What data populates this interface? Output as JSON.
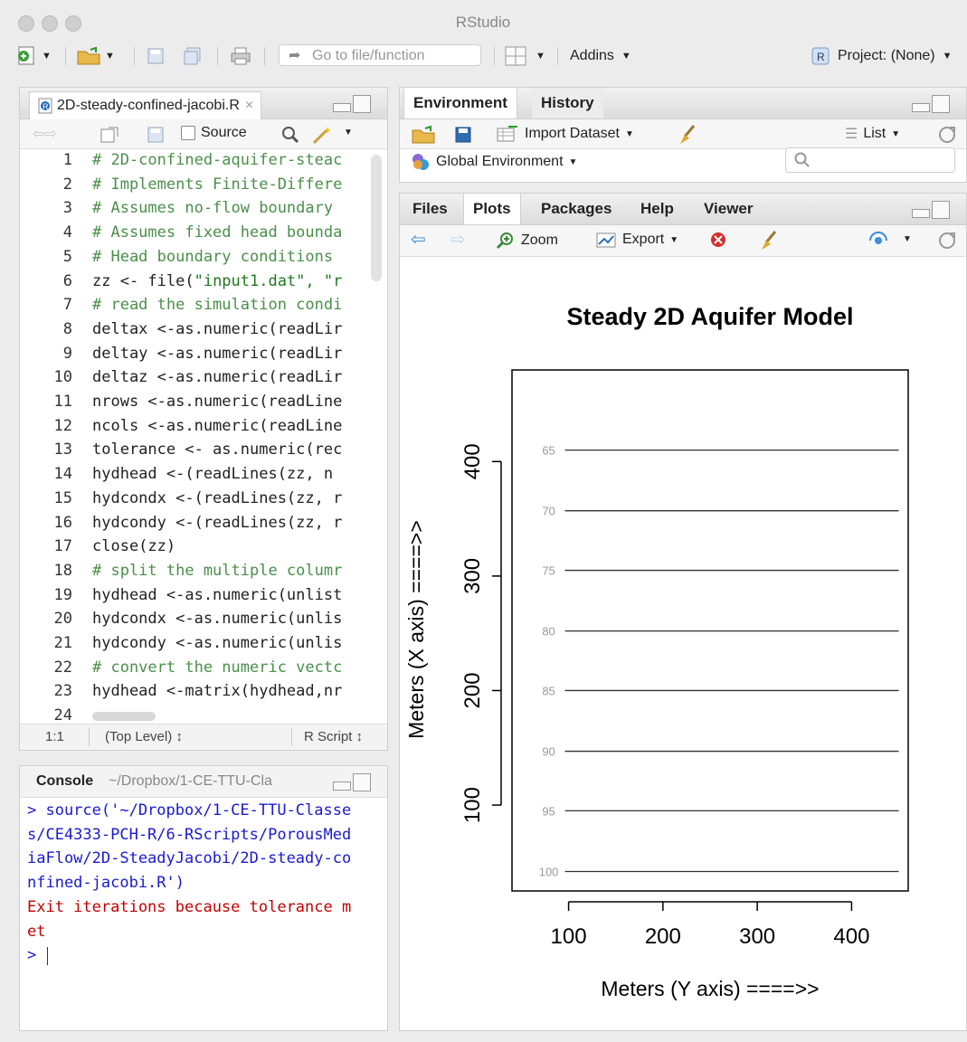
{
  "window": {
    "title": "RStudio"
  },
  "toolbar": {
    "goto_placeholder": "Go to file/function",
    "addins_label": "Addins",
    "project_label": "Project: (None)"
  },
  "editor": {
    "file_tab": "2D-steady-confined-jacobi.R",
    "tab_close": "×",
    "source_label": "Source",
    "lines": [
      {
        "n": "1",
        "t": "# 2D-confined-aquifer-steac",
        "k": "cm"
      },
      {
        "n": "2",
        "t": "# Implements Finite-Differe",
        "k": "cm"
      },
      {
        "n": "3",
        "t": "# Assumes no-flow boundary ",
        "k": "cm"
      },
      {
        "n": "4",
        "t": "# Assumes fixed head bounda",
        "k": "cm"
      },
      {
        "n": "5",
        "t": "# Head boundary conditions ",
        "k": "cm"
      },
      {
        "n": "6",
        "t": "zz <- file(\"input1.dat\", \"r",
        "k": "mix"
      },
      {
        "n": "7",
        "t": "# read the simulation condi",
        "k": "cm"
      },
      {
        "n": "8",
        "t": "deltax <-as.numeric(readLir",
        "k": ""
      },
      {
        "n": "9",
        "t": "deltay <-as.numeric(readLir",
        "k": ""
      },
      {
        "n": "10",
        "t": "deltaz <-as.numeric(readLir",
        "k": ""
      },
      {
        "n": "11",
        "t": "nrows <-as.numeric(readLine",
        "k": ""
      },
      {
        "n": "12",
        "t": "ncols <-as.numeric(readLine",
        "k": ""
      },
      {
        "n": "13",
        "t": "tolerance <- as.numeric(rec",
        "k": ""
      },
      {
        "n": "14",
        "t": "hydhead <-(readLines(zz, n ",
        "k": ""
      },
      {
        "n": "15",
        "t": "hydcondx <-(readLines(zz, r",
        "k": ""
      },
      {
        "n": "16",
        "t": "hydcondy <-(readLines(zz, r",
        "k": ""
      },
      {
        "n": "17",
        "t": "close(zz)",
        "k": ""
      },
      {
        "n": "18",
        "t": "# split the multiple columr",
        "k": "cm"
      },
      {
        "n": "19",
        "t": "hydhead <-as.numeric(unlist",
        "k": ""
      },
      {
        "n": "20",
        "t": "hydcondx <-as.numeric(unlis",
        "k": ""
      },
      {
        "n": "21",
        "t": "hydcondy <-as.numeric(unlis",
        "k": ""
      },
      {
        "n": "22",
        "t": "# convert the numeric vectc",
        "k": "cm"
      },
      {
        "n": "23",
        "t": "hydhead <-matrix(hydhead,nr",
        "k": ""
      },
      {
        "n": "24",
        "t": "",
        "k": ""
      }
    ],
    "status": {
      "position": "1:1",
      "scope": "(Top Level) ↕",
      "filetype": "R Script ↕"
    }
  },
  "console": {
    "title": "Console",
    "path": "~/Dropbox/1-CE-TTU-Cla",
    "lines": [
      {
        "t": "> source('~/Dropbox/1-CE-TTU-Classe",
        "c": "blue"
      },
      {
        "t": "s/CE4333-PCH-R/6-RScripts/PorousMed",
        "c": "blue"
      },
      {
        "t": "iaFlow/2D-SteadyJacobi/2D-steady-co",
        "c": "blue"
      },
      {
        "t": "nfined-jacobi.R')",
        "c": "blue"
      },
      {
        "t": "Exit iterations because tolerance m",
        "c": "red"
      },
      {
        "t": "et",
        "c": "red"
      },
      {
        "t": "> ",
        "c": "blue"
      }
    ]
  },
  "env_pane": {
    "tabs": [
      "Environment",
      "History"
    ],
    "import_label": "Import Dataset",
    "list_label": "List",
    "global_env": "Global Environment"
  },
  "plots_pane": {
    "tabs": [
      "Files",
      "Plots",
      "Packages",
      "Help",
      "Viewer"
    ],
    "zoom_label": "Zoom",
    "export_label": "Export"
  },
  "chart_data": {
    "type": "contour",
    "title": "Steady 2D Aquifer Model",
    "xlabel": "Meters (Y axis) ====>>",
    "ylabel": "Meters (X axis) ====>>",
    "xlim": [
      40,
      460
    ],
    "ylim": [
      25,
      480
    ],
    "xticks": [
      100,
      200,
      300,
      400
    ],
    "yticks": [
      100,
      200,
      300,
      400
    ],
    "x_range": [
      100,
      450
    ],
    "contours": [
      {
        "level": 65,
        "y": 410
      },
      {
        "level": 70,
        "y": 357
      },
      {
        "level": 75,
        "y": 305
      },
      {
        "level": 80,
        "y": 252
      },
      {
        "level": 85,
        "y": 200
      },
      {
        "level": 90,
        "y": 147
      },
      {
        "level": 95,
        "y": 95
      },
      {
        "level": 100,
        "y": 42
      }
    ]
  }
}
